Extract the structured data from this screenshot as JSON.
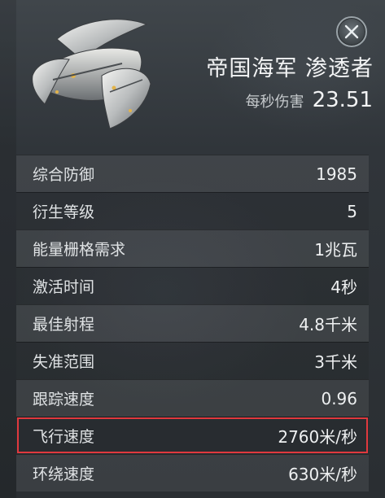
{
  "header": {
    "title": "帝国海军 渗透者",
    "dps_label": "每秒伤害",
    "dps_value": "23.51"
  },
  "stats": [
    {
      "label": "综合防御",
      "value": "1985"
    },
    {
      "label": "衍生等级",
      "value": "5"
    },
    {
      "label": "能量栅格需求",
      "value": "1兆瓦"
    },
    {
      "label": "激活时间",
      "value": "4秒"
    },
    {
      "label": "最佳射程",
      "value": "4.8千米"
    },
    {
      "label": "失准范围",
      "value": "3千米"
    },
    {
      "label": "跟踪速度",
      "value": "0.96"
    },
    {
      "label": "飞行速度",
      "value": "2760米/秒",
      "highlighted": true
    },
    {
      "label": "环绕速度",
      "value": "630米/秒"
    }
  ],
  "icons": {
    "close": "close-icon",
    "ship": "drone-ship-icon"
  },
  "colors": {
    "highlight": "#e0393e",
    "background": "#2b2f33"
  }
}
